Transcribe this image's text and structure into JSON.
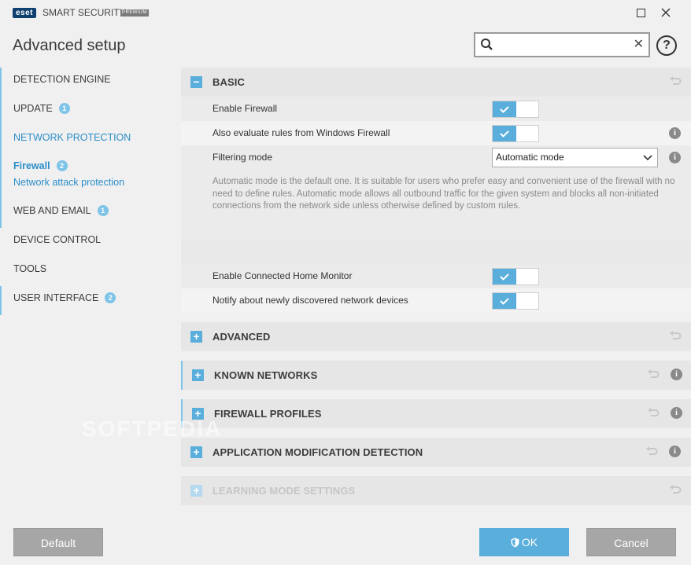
{
  "titlebar": {
    "logo": "eset",
    "product": "SMART SECURITY",
    "edition": "PREMIUM"
  },
  "page_title": "Advanced setup",
  "search": {
    "value": "",
    "placeholder": ""
  },
  "help_label": "?",
  "sidebar": {
    "items": [
      {
        "label": "DETECTION ENGINE"
      },
      {
        "label": "UPDATE",
        "badge": "1"
      },
      {
        "label": "NETWORK PROTECTION"
      },
      {
        "label": "WEB AND EMAIL",
        "badge": "1"
      },
      {
        "label": "DEVICE CONTROL"
      },
      {
        "label": "TOOLS"
      },
      {
        "label": "USER INTERFACE",
        "badge": "2"
      }
    ],
    "sub_items": [
      {
        "label": "Firewall",
        "badge": "2"
      },
      {
        "label": "Network attack protection"
      }
    ]
  },
  "basic": {
    "title": "BASIC",
    "toggle": "−",
    "rows": [
      {
        "label": "Enable Firewall",
        "enabled": true
      },
      {
        "label": "Also evaluate rules from Windows Firewall",
        "enabled": true
      },
      {
        "label": "Filtering mode",
        "value": "Automatic mode"
      }
    ],
    "description": "Automatic mode is the default one. It is suitable for users who prefer easy and convenient use of the firewall with no need to define rules. Automatic mode allows all outbound traffic for the given system and blocks all non-initiated connections from the network side unless otherwise defined by custom rules.",
    "rows2": [
      {
        "label": "Enable Connected Home Monitor",
        "enabled": true
      },
      {
        "label": "Notify about newly discovered network devices",
        "enabled": true
      }
    ]
  },
  "sections": [
    {
      "title": "ADVANCED",
      "toggle": "+"
    },
    {
      "title": "KNOWN NETWORKS",
      "toggle": "+"
    },
    {
      "title": "FIREWALL PROFILES",
      "toggle": "+"
    },
    {
      "title": "APPLICATION MODIFICATION DETECTION",
      "toggle": "+"
    },
    {
      "title": "LEARNING MODE SETTINGS",
      "toggle": "+"
    }
  ],
  "info_glyph": "i",
  "watermark": "SOFTPEDIA",
  "footer": {
    "default_label": "Default",
    "ok_label": "OK",
    "cancel_label": "Cancel"
  },
  "colors": {
    "accent": "#5aaedc",
    "link": "#2a8ec9",
    "button_gray": "#a6a6a6"
  }
}
